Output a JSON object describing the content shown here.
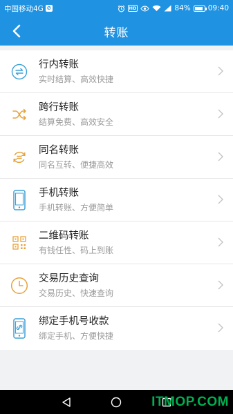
{
  "status_bar": {
    "carrier": "中国移动4G",
    "battery": "84%",
    "battery_level": 0.84,
    "time": "09:40",
    "hd_badge": "HD"
  },
  "header": {
    "title": "转账"
  },
  "menu": {
    "items": [
      {
        "title": "行内转账",
        "subtitle": "实时结算、高效快捷",
        "icon": "arrows-exchange-icon",
        "color": "#3aa0d8"
      },
      {
        "title": "跨行转账",
        "subtitle": "结算免费、高效安全",
        "icon": "shuffle-icon",
        "color": "#e8a23a"
      },
      {
        "title": "同名转账",
        "subtitle": "同名互转、便捷高效",
        "icon": "refresh-equal-icon",
        "color": "#e8a23a"
      },
      {
        "title": "手机转账",
        "subtitle": "手机转账、方便简单",
        "icon": "mobile-phone-icon",
        "color": "#3aa0d8"
      },
      {
        "title": "二维码转账",
        "subtitle": "有钱任性、码上到账",
        "icon": "qr-code-icon",
        "color": "#e8a23a"
      },
      {
        "title": "交易历史查询",
        "subtitle": "交易历史、快速查询",
        "icon": "clock-icon",
        "color": "#e8a23a"
      },
      {
        "title": "绑定手机号收款",
        "subtitle": "绑定手机、方便快捷",
        "icon": "phone-link-icon",
        "color": "#3aa0d8"
      }
    ]
  },
  "watermark": "ITMOP.COM"
}
